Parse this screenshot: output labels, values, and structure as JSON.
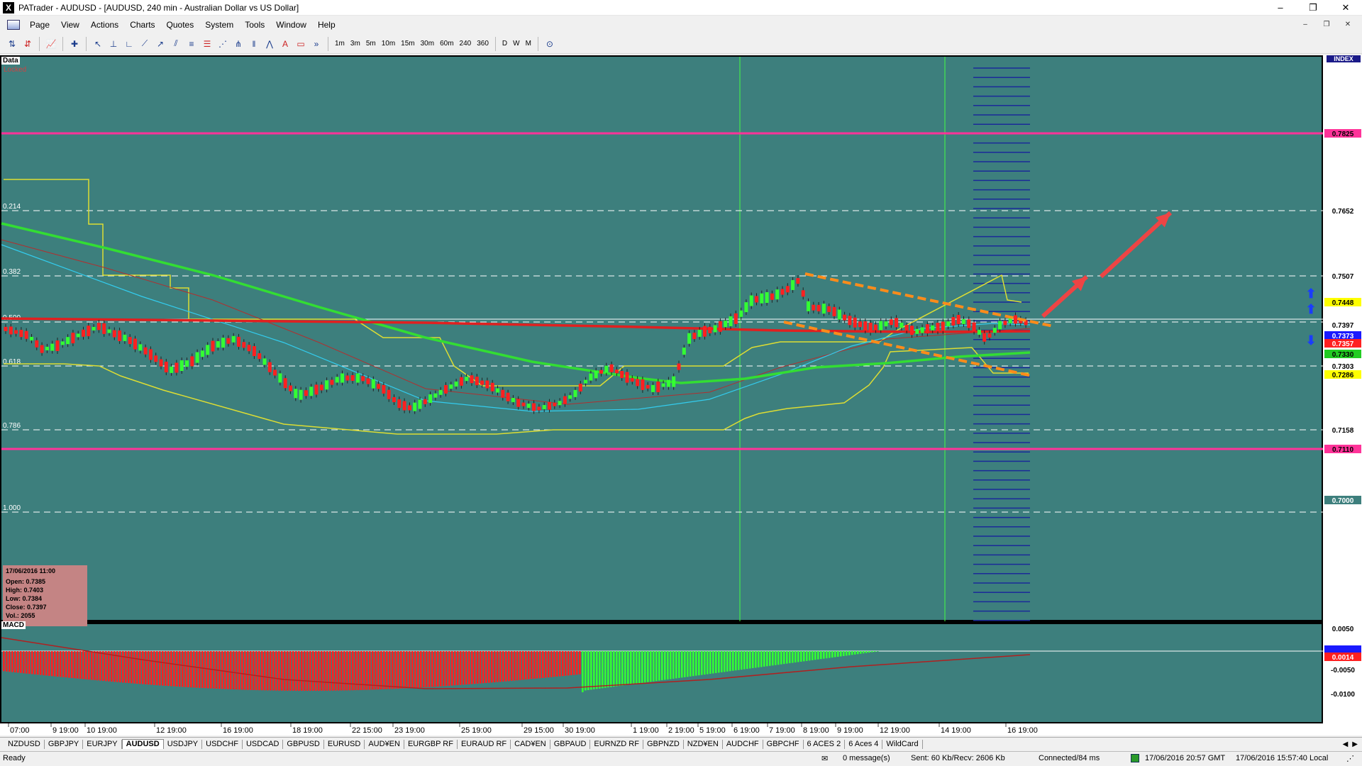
{
  "window": {
    "title": "PATrader - AUDUSD - [AUDUSD, 240 min - Australian Dollar vs US Dollar]",
    "app_icon_letter": "X",
    "controls": [
      "–",
      "❐",
      "✕"
    ]
  },
  "menu": {
    "items": [
      "Page",
      "View",
      "Actions",
      "Charts",
      "Quotes",
      "System",
      "Tools",
      "Window",
      "Help"
    ],
    "mdi_controls": [
      "–",
      "❐",
      "✕"
    ]
  },
  "toolbar": {
    "timeframes": [
      "1m",
      "3m",
      "5m",
      "10m",
      "15m",
      "30m",
      "60m",
      "240",
      "360"
    ],
    "periods": [
      "D",
      "W",
      "M"
    ],
    "overflow": "»"
  },
  "chart": {
    "data_label": "Data",
    "locked_label": "Locked",
    "index_label": "INDEX",
    "fib_labels": [
      "0.214",
      "0.382",
      "0.500",
      "0.618",
      "0.786",
      "1.000"
    ],
    "price_labels": [
      {
        "text": "0.7825",
        "bg": "#ff3399",
        "fg": "#ff3399"
      },
      {
        "text": "0.7652",
        "bg": "#ffffff",
        "fg": "#000000"
      },
      {
        "text": "0.7507",
        "bg": "#ffffff",
        "fg": "#000000"
      },
      {
        "text": "0.7448",
        "bg": "#ffff00",
        "fg": "#000000"
      },
      {
        "text": "0.7397",
        "bg": "#ffffff",
        "fg": "#000000"
      },
      {
        "text": "0.7373",
        "bg": "#1a1aff",
        "fg": "#ffffff"
      },
      {
        "text": "0.7357",
        "bg": "#ff2020",
        "fg": "#ffffff"
      },
      {
        "text": "0.7330",
        "bg": "#22cc22",
        "fg": "#000000"
      },
      {
        "text": "0.7303",
        "bg": "#ffffff",
        "fg": "#000000"
      },
      {
        "text": "0.7286",
        "bg": "#ffff00",
        "fg": "#000000"
      },
      {
        "text": "0.7158",
        "bg": "#ffffff",
        "fg": "#000000"
      },
      {
        "text": "0.7110",
        "bg": "#ff3399",
        "fg": "#ff3399"
      },
      {
        "text": "0.7000",
        "bg": "#3d7f7d",
        "fg": "#ffffff"
      }
    ],
    "macd": {
      "label": "MACD",
      "scale": [
        "0.0050",
        "0.0000",
        "0.0014",
        "-0.0050",
        "-0.0100"
      ]
    },
    "time_labels": [
      "07:00",
      "9 19:00",
      "10 19:00",
      "12 19:00",
      "16 19:00",
      "18 19:00",
      "22 15:00",
      "23 19:00",
      "25 19:00",
      "29 15:00",
      "30 19:00",
      "1 19:00",
      "2 19:00",
      "5 19:00",
      "6 19:00",
      "7 19:00",
      "8 19:00",
      "9 19:00",
      "12 19:00",
      "14 19:00",
      "16 19:00"
    ],
    "info": {
      "date": "17/06/2016 11:00",
      "open": "Open: 0.7385",
      "high": "High: 0.7403",
      "low": "Low: 0.7384",
      "close": "Close: 0.7397",
      "vol": "Vol.: 2055"
    },
    "colors": {
      "background": "#3d7f7d",
      "bull_candle": "#33ff33",
      "bear_candle": "#ff2020",
      "fib_line": "#ffffff",
      "magenta_line": "#ff3399",
      "ma_red": "#e02020",
      "ma_green": "#33dd33",
      "ma_cyan": "#33ccee",
      "channel_yellow": "#dddd33",
      "trend_orange": "#ff8c1a",
      "arrow_red": "#ee4444"
    }
  },
  "symbol_tabs": [
    "NZDUSD",
    "GBPJPY",
    "EURJPY",
    "AUDUSD",
    "USDJPY",
    "USDCHF",
    "USDCAD",
    "GBPUSD",
    "EURUSD",
    "AUD¥EN",
    "EURGBP RF",
    "EURAUD RF",
    "CAD¥EN",
    "GBPAUD",
    "EURNZD RF",
    "GBPNZD",
    "NZD¥EN",
    "AUDCHF",
    "GBPCHF",
    "6 ACES 2",
    "6 Aces 4",
    "WildCard"
  ],
  "active_symbol": "AUDUSD",
  "status": {
    "ready": "Ready",
    "messages": "0 message(s)",
    "traffic": "Sent: 60 Kb/Recv: 2606 Kb",
    "connection": "Connected/84 ms",
    "server_time": "17/06/2016 20:57 GMT",
    "local_time": "17/06/2016 15:57:40 Local"
  }
}
